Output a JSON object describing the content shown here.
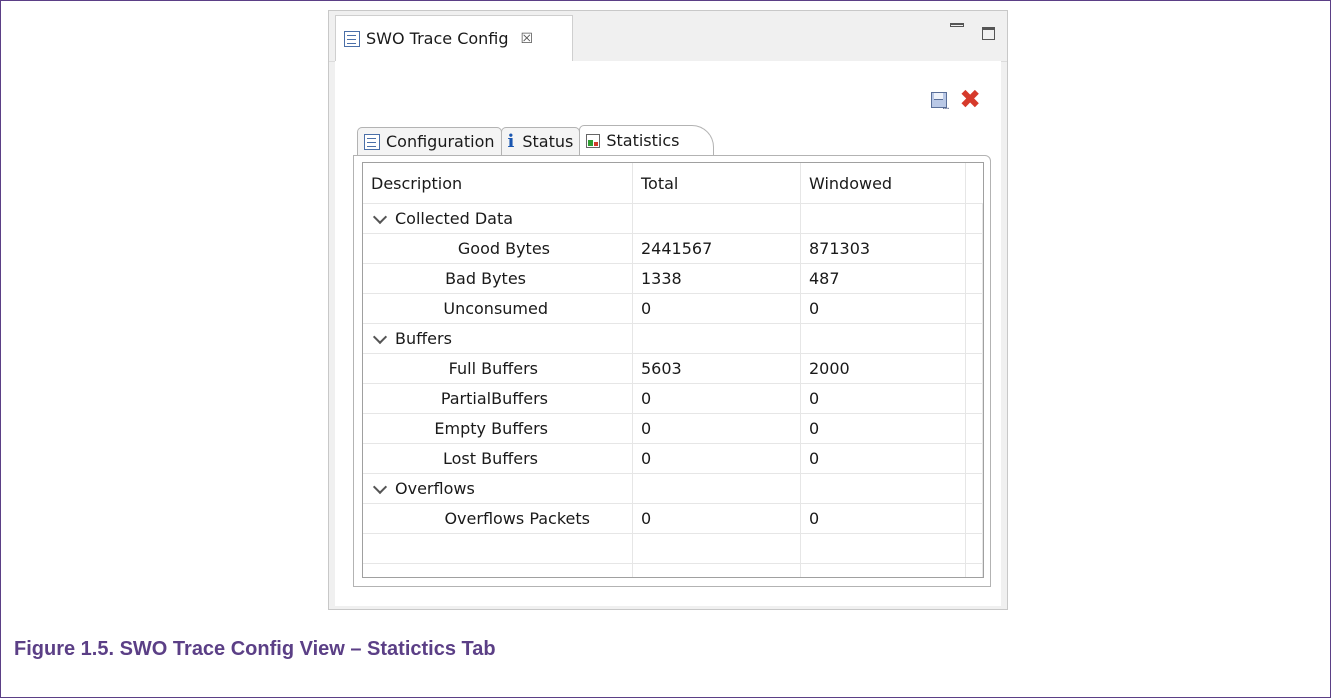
{
  "view": {
    "tab_title": "SWO Trace Config",
    "tab_close": "☒"
  },
  "tabs": [
    {
      "label": "Configuration"
    },
    {
      "label": "Status"
    },
    {
      "label": "Statistics"
    }
  ],
  "table": {
    "headers": [
      "Description",
      "Total",
      "Windowed"
    ],
    "groups": [
      {
        "name": "Collected Data",
        "rows": [
          {
            "label": "Good Bytes",
            "total": "2441567",
            "windowed": "871303"
          },
          {
            "label": "Bad Bytes",
            "total": "1338",
            "windowed": "487"
          },
          {
            "label": "Unconsumed",
            "total": "0",
            "windowed": "0"
          }
        ]
      },
      {
        "name": "Buffers",
        "rows": [
          {
            "label": "Full Buffers",
            "total": "5603",
            "windowed": "2000"
          },
          {
            "label": "PartialBuffers",
            "total": "0",
            "windowed": "0"
          },
          {
            "label": "Empty Buffers",
            "total": "0",
            "windowed": "0"
          },
          {
            "label": "Lost Buffers",
            "total": "0",
            "windowed": "0"
          }
        ]
      },
      {
        "name": "Overflows",
        "rows": [
          {
            "label": "Overflows Packets",
            "total": "0",
            "windowed": "0"
          }
        ]
      }
    ]
  },
  "caption": "Figure 1.5. SWO Trace Config View – Statictics Tab",
  "colors": {
    "caption": "#5b3f86",
    "delete": "#d63a2b",
    "info": "#1a56b0"
  }
}
